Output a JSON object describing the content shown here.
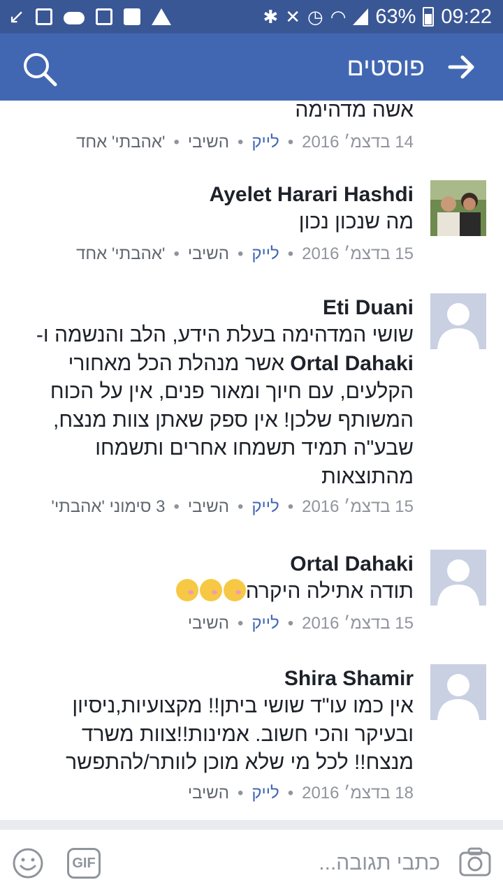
{
  "status_bar": {
    "battery": "63%",
    "time": "09:22"
  },
  "app_bar": {
    "title": "פוסטים",
    "search_icon": "search-icon",
    "back_icon": "arrow-right-icon"
  },
  "comments": [
    {
      "text_lines": [
        "אשה מדהימה"
      ],
      "date": "14 בדצמ׳ 2016",
      "like": "לייק",
      "reply": "השיבי",
      "reactions": "'אהבתי' אחד"
    },
    {
      "name": "Ayelet Harari Hashdi",
      "text_lines": [
        "מה שנכון נכון"
      ],
      "date": "15 בדצמ׳ 2016",
      "like": "לייק",
      "reply": "השיבי",
      "reactions": "'אהבתי' אחד"
    },
    {
      "name": "Eti Duani",
      "text_lines": [
        "שושי המדהימה בעלת הידע, הלב והנשמה ו-",
        "Ortal Dahaki",
        "אשר מנהלת הכל מאחורי",
        "הקלעים, עם חיוך ומאור פנים, אין על הכוח",
        "המשותף שלכן! אין ספק שאתן צוות מנצח,",
        "שבע\"ה תמיד תשמחו אחרים ותשמחו",
        "מהתוצאות"
      ],
      "date": "15 בדצמ׳ 2016",
      "like": "לייק",
      "reply": "השיבי",
      "reactions": "3 סימוני 'אהבתי'"
    },
    {
      "name": "Ortal Dahaki",
      "text_lines": [
        "תודה אתילה היקרה"
      ],
      "emoji_count": 3,
      "date": "15 בדצמ׳ 2016",
      "like": "לייק",
      "reply": "השיבי"
    },
    {
      "name": "Shira Shamir",
      "text_lines": [
        "אין כמו עו\"ד שושי ביתן!! מקצועיות,ניסיון",
        "ובעיקר והכי חשוב. אמינות!!צוות משרד",
        "מנצח!! לכל מי שלא מוכן לוותר/להתפשר"
      ],
      "date": "18 בדצמ׳ 2016",
      "like": "לייק",
      "reply": "השיבי"
    }
  ],
  "composer": {
    "placeholder": "כתבי תגובה...",
    "gif_label": "GIF",
    "emoji_icon": "smiley-icon",
    "camera_icon": "camera-icon"
  },
  "colors": {
    "status_bar": "#3a5795",
    "app_bar": "#4267b2",
    "link": "#4267b2",
    "meta": "#90949c"
  }
}
